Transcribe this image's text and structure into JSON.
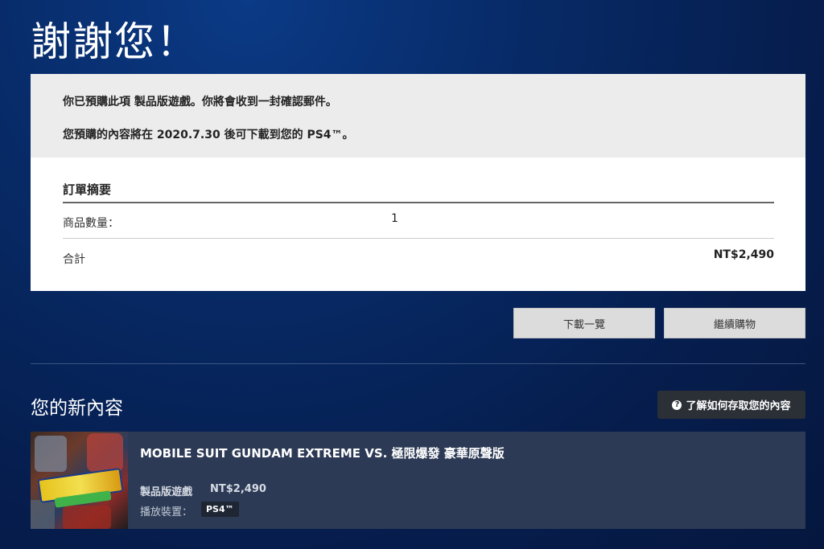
{
  "page": {
    "title": "謝謝您！"
  },
  "notice": {
    "line1": "你已預購此項 製品版遊戲。你將會收到一封確認郵件。",
    "line2": "您預購的內容將在 2020.7.30 後可下載到您的 PS4™。"
  },
  "summary": {
    "title": "訂單摘要",
    "rows": [
      {
        "label": "商品數量：",
        "value": "1"
      },
      {
        "label": "合計",
        "value": "NT$2,490"
      }
    ]
  },
  "actions": {
    "download_list": "下載一覽",
    "continue_shopping": "繼續購物"
  },
  "new_content": {
    "title": "您的新內容",
    "help_button": "了解如何存取您的內容",
    "help_icon": "question-circle-icon"
  },
  "product": {
    "name": "MOBILE SUIT GUNDAM EXTREME VS. 極限爆發 豪華原聲版",
    "type": "製品版遊戲",
    "price": "NT$2,490",
    "platform_label": "播放裝置：",
    "platform": "PS4™"
  },
  "colors": {
    "background": "#072a66",
    "card": "#ffffff",
    "notice_band": "#ececec",
    "product_card": "#2c3a55",
    "button": "#dcdcdc",
    "help_button": "#2b2f36"
  }
}
